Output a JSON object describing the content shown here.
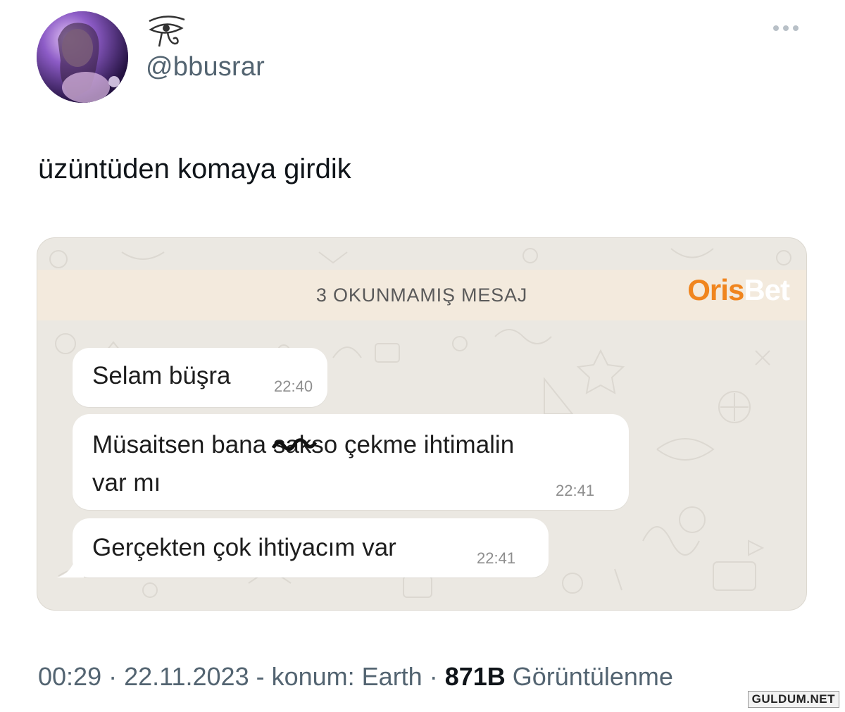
{
  "tweet": {
    "handle": "@bbusrar",
    "text": "üzüntüden komaya girdik"
  },
  "chat": {
    "unread_banner": "3 OKUNMAMIŞ MESAJ",
    "watermark_a": "Oris",
    "watermark_b": "Bet",
    "messages": [
      {
        "line1": "Selam büşra",
        "line2": "",
        "time": "22:40"
      },
      {
        "line1_pre": "Müsaitsen bana ",
        "line1_scribble": "sak",
        "line1_post": "so çekme ihtimalin",
        "line2": "var mı",
        "time": "22:41"
      },
      {
        "line1": "Gerçekten çok ihtiyacım var",
        "line2": "",
        "time": "22:41"
      }
    ]
  },
  "meta": {
    "time": "00:29",
    "sep1": " · ",
    "date": "22.11.2023",
    "location": " - konum: Earth",
    "sep2": " · ",
    "views": "871B",
    "views_label": " Görüntülenme"
  },
  "site_mark": "GULDUM.NET",
  "colors": {
    "orange": "#f0851e",
    "muted": "#536471",
    "chat_bg": "#ebe8e2",
    "banner_bg": "#f3eadd"
  }
}
